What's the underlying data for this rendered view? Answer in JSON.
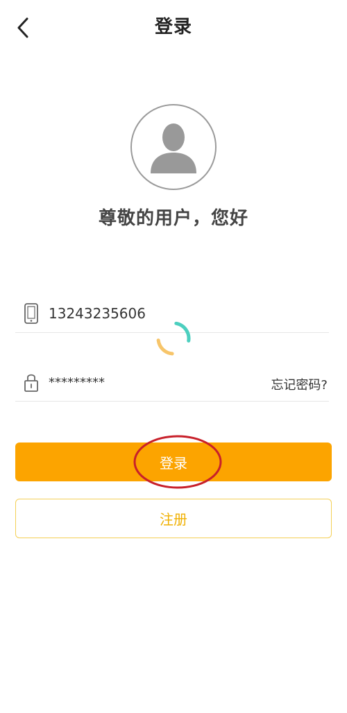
{
  "header": {
    "title": "登录",
    "back_icon": "chevron-left-icon"
  },
  "profile": {
    "avatar_icon": "user-silhouette-icon",
    "greeting": "尊敬的用户，您好"
  },
  "form": {
    "phone": {
      "icon": "phone-icon",
      "value": "13243235606"
    },
    "password": {
      "icon": "lock-icon",
      "value": "*********",
      "forgot_label": "忘记密码?"
    }
  },
  "actions": {
    "login_label": "登录",
    "register_label": "注册"
  },
  "colors": {
    "primary": "#fca400",
    "register_border": "#f4cf54",
    "register_text": "#f0b000",
    "annotation": "#c8202a",
    "spinner_teal": "#4ccfbf",
    "spinner_yellow": "#f7c56a"
  }
}
